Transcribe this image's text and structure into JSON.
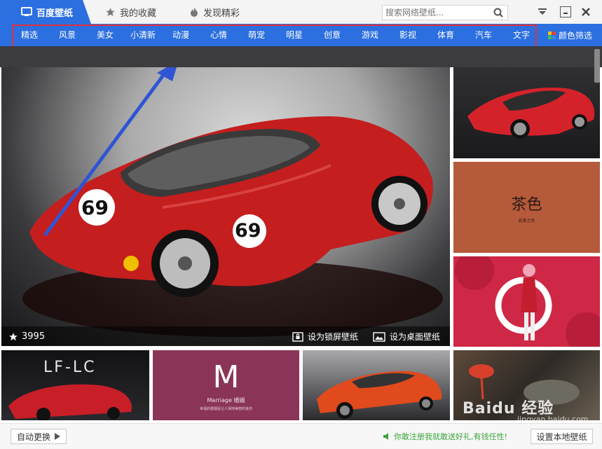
{
  "titlebar": {
    "tabs": [
      {
        "label": "百度壁纸",
        "icon": "wallpaper-icon"
      },
      {
        "label": "我的收藏",
        "icon": "star-icon"
      },
      {
        "label": "发现精彩",
        "icon": "flame-icon"
      }
    ],
    "search_placeholder": "搜索网络壁纸...",
    "colors": {
      "accent": "#2b6fe0",
      "highlight_border": "#e0303c"
    }
  },
  "categories": [
    "精选",
    "风景",
    "美女",
    "小清新",
    "动漫",
    "心情",
    "萌宠",
    "明星",
    "创意",
    "游戏",
    "影视",
    "体育",
    "汽车",
    "文字"
  ],
  "color_filter_label": "颜色筛选",
  "main_image": {
    "likes": "3995",
    "set_lock_label": "设为锁屏壁纸",
    "set_desktop_label": "设为桌面壁纸",
    "race_number": "69"
  },
  "thumbnails": {
    "tea_title": "茶色",
    "tea_caption": "品茶之色",
    "lexus_logo": "LF-LC",
    "marriage_letter": "M",
    "marriage_text": "Marriage 婚姻",
    "marriage_caption": "幸福的婚姻是让人保持美丽的良药"
  },
  "watermark": {
    "brand": "Baidu 经验",
    "url": "jingyan.baidu.com"
  },
  "footer": {
    "auto_change_label": "自动更换",
    "promo_text": "你敢注册我就敢送好礼,有钱任性!",
    "set_local_label": "设置本地壁纸"
  }
}
